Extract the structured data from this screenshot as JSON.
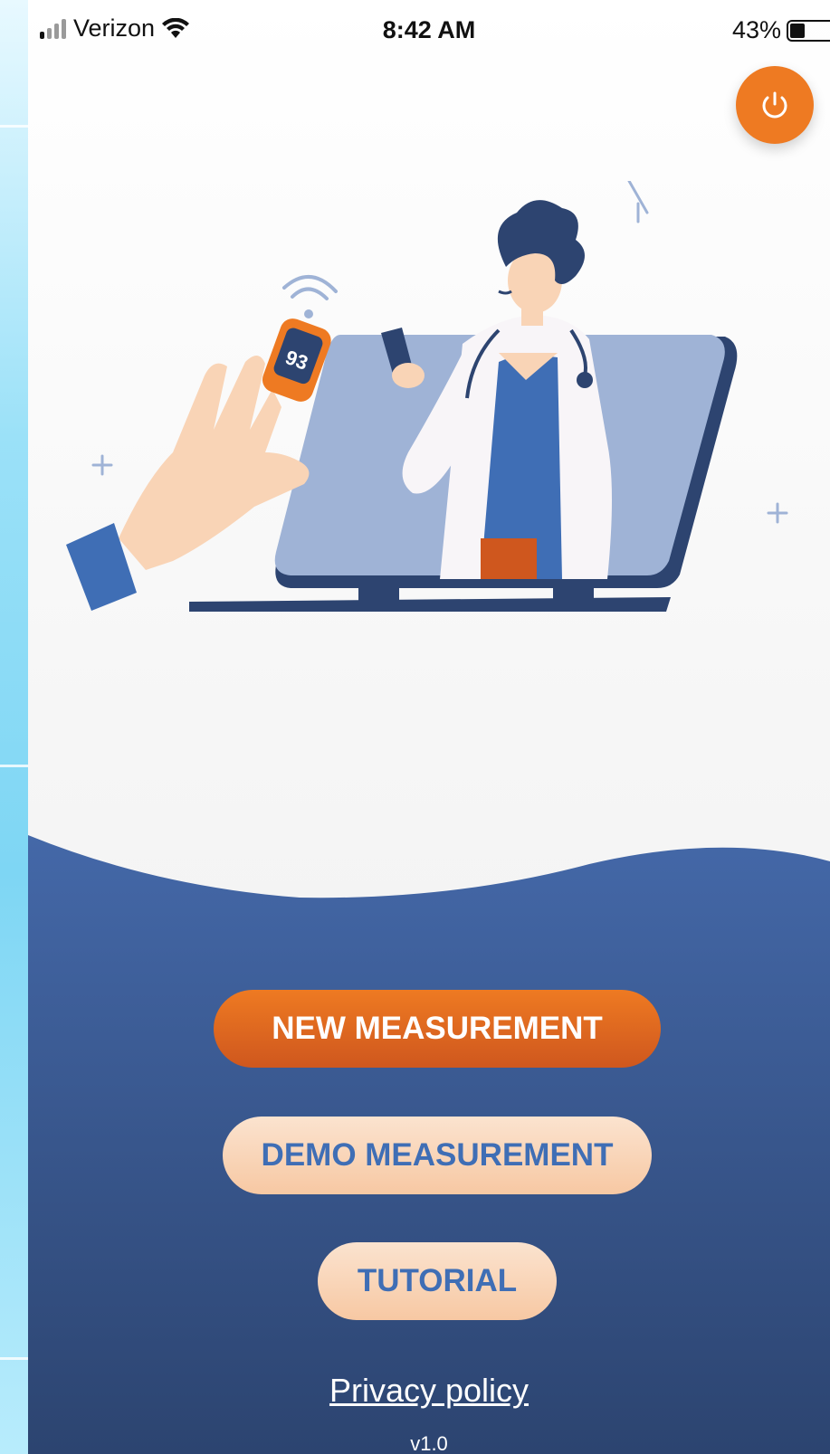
{
  "status_bar": {
    "carrier": "Verizon",
    "time": "8:42 AM",
    "battery_percent": "43%",
    "battery_level": 0.43
  },
  "icons": {
    "signal": "cellular-signal-icon",
    "wifi": "wifi-icon",
    "battery": "battery-icon",
    "power": "power-icon"
  },
  "illustration": {
    "oximeter_reading": "93"
  },
  "buttons": {
    "new_measurement": "NEW MEASUREMENT",
    "demo_measurement": "DEMO MEASUREMENT",
    "tutorial": "TUTORIAL"
  },
  "footer": {
    "privacy_policy": "Privacy policy",
    "version": "v1.0"
  },
  "colors": {
    "accent_orange": "#ee7a22",
    "brand_blue": "#3f6eb5",
    "navy": "#2e4470",
    "peach": "#f9d4b6"
  }
}
